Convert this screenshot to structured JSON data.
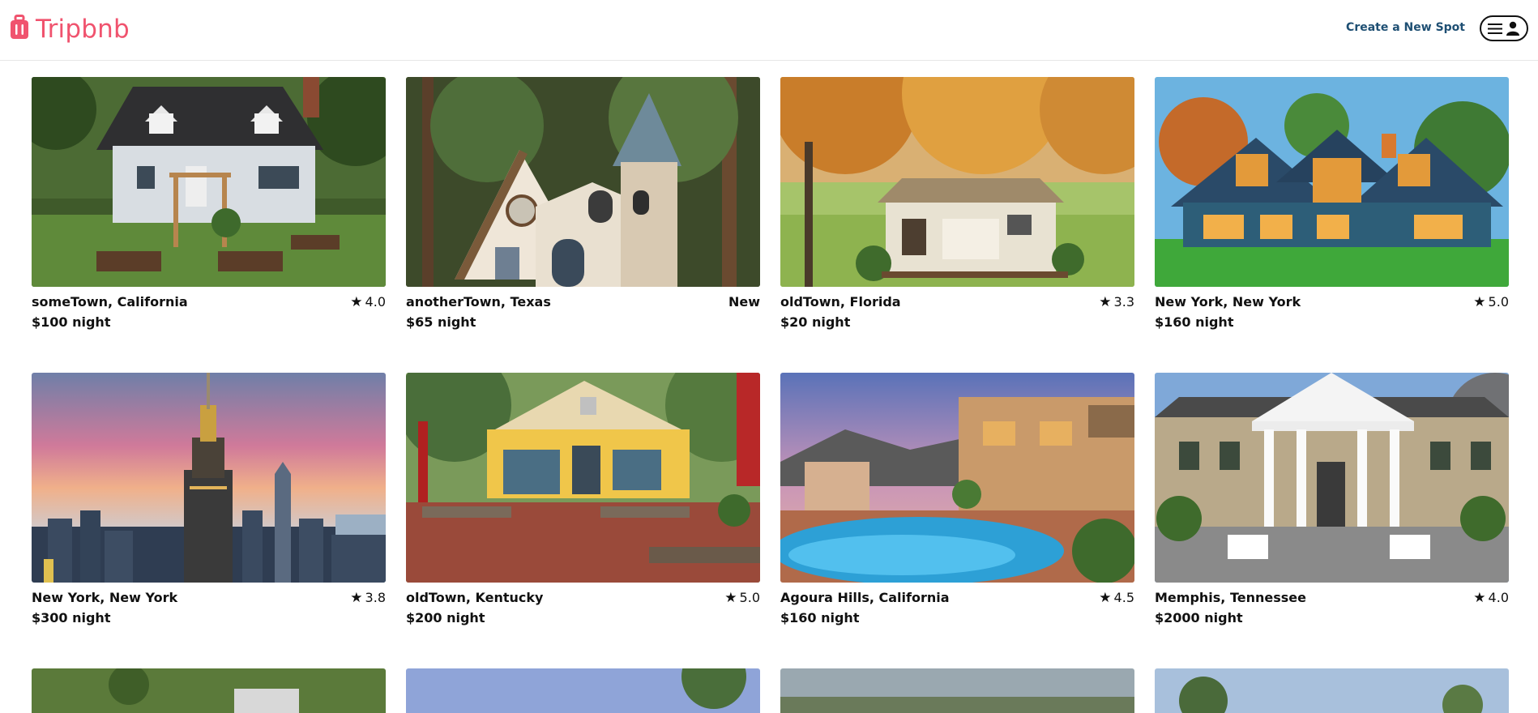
{
  "header": {
    "brand": "Tripbnb",
    "create_link": "Create a New Spot"
  },
  "spots": [
    {
      "location": "someTown, California",
      "rating": "4.0",
      "price": "$100 night"
    },
    {
      "location": "anotherTown, Texas",
      "rating": "New",
      "price": "$65 night"
    },
    {
      "location": "oldTown, Florida",
      "rating": "3.3",
      "price": "$20 night"
    },
    {
      "location": "New York, New York",
      "rating": "5.0",
      "price": "$160 night"
    },
    {
      "location": "New York, New York",
      "rating": "3.8",
      "price": "$300 night"
    },
    {
      "location": "oldTown, Kentucky",
      "rating": "5.0",
      "price": "$200 night"
    },
    {
      "location": "Agoura Hills, California",
      "rating": "4.5",
      "price": "$160 night"
    },
    {
      "location": "Memphis, Tennessee",
      "rating": "4.0",
      "price": "$2000 night"
    }
  ],
  "colors": {
    "brand": "#f0536e",
    "link": "#1e4f73"
  }
}
